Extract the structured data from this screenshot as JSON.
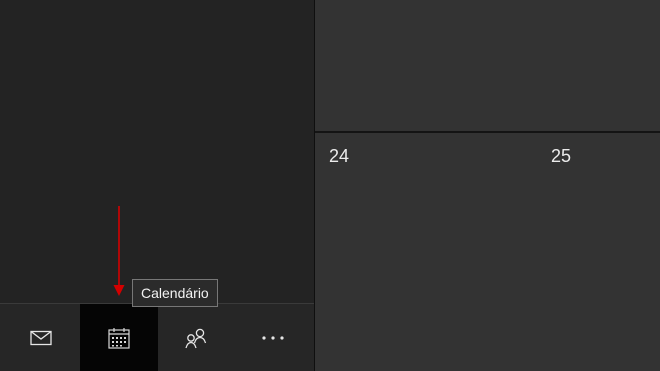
{
  "calendar": {
    "days": [
      "24",
      "25"
    ]
  },
  "nav": {
    "items": [
      {
        "icon": "mail-icon"
      },
      {
        "icon": "calendar-icon",
        "selected": true
      },
      {
        "icon": "people-icon"
      },
      {
        "icon": "more-icon"
      }
    ]
  },
  "tooltip": {
    "text": "Calendário"
  },
  "annotation": {
    "arrow_color": "#d40000"
  }
}
